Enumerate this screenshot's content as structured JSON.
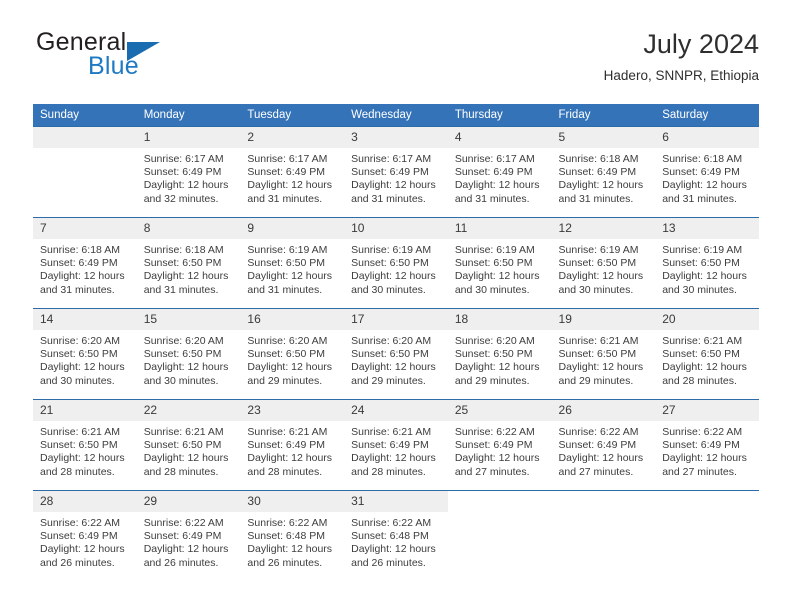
{
  "brand": {
    "line1": "General",
    "line2": "Blue",
    "triangle_color": "#1a6cb0",
    "blue_color": "#1f7ac4"
  },
  "header": {
    "month_title": "July 2024",
    "location": "Hadero, SNNPR, Ethiopia"
  },
  "theme": {
    "header_row_bg": "#3573b9",
    "daynum_bg": "#efefef",
    "row_divider": "#2d6ca8",
    "text": "#3d3d3d"
  },
  "weekdays": [
    "Sunday",
    "Monday",
    "Tuesday",
    "Wednesday",
    "Thursday",
    "Friday",
    "Saturday"
  ],
  "labels": {
    "sunrise_prefix": "Sunrise:",
    "sunset_prefix": "Sunset:",
    "daylight_prefix": "Daylight:"
  },
  "weeks": [
    [
      {
        "day": "",
        "sunrise": "",
        "sunset": "",
        "daylight": "",
        "empty": true
      },
      {
        "day": "1",
        "sunrise": "Sunrise: 6:17 AM",
        "sunset": "Sunset: 6:49 PM",
        "daylight": "Daylight: 12 hours and 32 minutes."
      },
      {
        "day": "2",
        "sunrise": "Sunrise: 6:17 AM",
        "sunset": "Sunset: 6:49 PM",
        "daylight": "Daylight: 12 hours and 31 minutes."
      },
      {
        "day": "3",
        "sunrise": "Sunrise: 6:17 AM",
        "sunset": "Sunset: 6:49 PM",
        "daylight": "Daylight: 12 hours and 31 minutes."
      },
      {
        "day": "4",
        "sunrise": "Sunrise: 6:17 AM",
        "sunset": "Sunset: 6:49 PM",
        "daylight": "Daylight: 12 hours and 31 minutes."
      },
      {
        "day": "5",
        "sunrise": "Sunrise: 6:18 AM",
        "sunset": "Sunset: 6:49 PM",
        "daylight": "Daylight: 12 hours and 31 minutes."
      },
      {
        "day": "6",
        "sunrise": "Sunrise: 6:18 AM",
        "sunset": "Sunset: 6:49 PM",
        "daylight": "Daylight: 12 hours and 31 minutes."
      }
    ],
    [
      {
        "day": "7",
        "sunrise": "Sunrise: 6:18 AM",
        "sunset": "Sunset: 6:49 PM",
        "daylight": "Daylight: 12 hours and 31 minutes."
      },
      {
        "day": "8",
        "sunrise": "Sunrise: 6:18 AM",
        "sunset": "Sunset: 6:50 PM",
        "daylight": "Daylight: 12 hours and 31 minutes."
      },
      {
        "day": "9",
        "sunrise": "Sunrise: 6:19 AM",
        "sunset": "Sunset: 6:50 PM",
        "daylight": "Daylight: 12 hours and 31 minutes."
      },
      {
        "day": "10",
        "sunrise": "Sunrise: 6:19 AM",
        "sunset": "Sunset: 6:50 PM",
        "daylight": "Daylight: 12 hours and 30 minutes."
      },
      {
        "day": "11",
        "sunrise": "Sunrise: 6:19 AM",
        "sunset": "Sunset: 6:50 PM",
        "daylight": "Daylight: 12 hours and 30 minutes."
      },
      {
        "day": "12",
        "sunrise": "Sunrise: 6:19 AM",
        "sunset": "Sunset: 6:50 PM",
        "daylight": "Daylight: 12 hours and 30 minutes."
      },
      {
        "day": "13",
        "sunrise": "Sunrise: 6:19 AM",
        "sunset": "Sunset: 6:50 PM",
        "daylight": "Daylight: 12 hours and 30 minutes."
      }
    ],
    [
      {
        "day": "14",
        "sunrise": "Sunrise: 6:20 AM",
        "sunset": "Sunset: 6:50 PM",
        "daylight": "Daylight: 12 hours and 30 minutes."
      },
      {
        "day": "15",
        "sunrise": "Sunrise: 6:20 AM",
        "sunset": "Sunset: 6:50 PM",
        "daylight": "Daylight: 12 hours and 30 minutes."
      },
      {
        "day": "16",
        "sunrise": "Sunrise: 6:20 AM",
        "sunset": "Sunset: 6:50 PM",
        "daylight": "Daylight: 12 hours and 29 minutes."
      },
      {
        "day": "17",
        "sunrise": "Sunrise: 6:20 AM",
        "sunset": "Sunset: 6:50 PM",
        "daylight": "Daylight: 12 hours and 29 minutes."
      },
      {
        "day": "18",
        "sunrise": "Sunrise: 6:20 AM",
        "sunset": "Sunset: 6:50 PM",
        "daylight": "Daylight: 12 hours and 29 minutes."
      },
      {
        "day": "19",
        "sunrise": "Sunrise: 6:21 AM",
        "sunset": "Sunset: 6:50 PM",
        "daylight": "Daylight: 12 hours and 29 minutes."
      },
      {
        "day": "20",
        "sunrise": "Sunrise: 6:21 AM",
        "sunset": "Sunset: 6:50 PM",
        "daylight": "Daylight: 12 hours and 28 minutes."
      }
    ],
    [
      {
        "day": "21",
        "sunrise": "Sunrise: 6:21 AM",
        "sunset": "Sunset: 6:50 PM",
        "daylight": "Daylight: 12 hours and 28 minutes."
      },
      {
        "day": "22",
        "sunrise": "Sunrise: 6:21 AM",
        "sunset": "Sunset: 6:50 PM",
        "daylight": "Daylight: 12 hours and 28 minutes."
      },
      {
        "day": "23",
        "sunrise": "Sunrise: 6:21 AM",
        "sunset": "Sunset: 6:49 PM",
        "daylight": "Daylight: 12 hours and 28 minutes."
      },
      {
        "day": "24",
        "sunrise": "Sunrise: 6:21 AM",
        "sunset": "Sunset: 6:49 PM",
        "daylight": "Daylight: 12 hours and 28 minutes."
      },
      {
        "day": "25",
        "sunrise": "Sunrise: 6:22 AM",
        "sunset": "Sunset: 6:49 PM",
        "daylight": "Daylight: 12 hours and 27 minutes."
      },
      {
        "day": "26",
        "sunrise": "Sunrise: 6:22 AM",
        "sunset": "Sunset: 6:49 PM",
        "daylight": "Daylight: 12 hours and 27 minutes."
      },
      {
        "day": "27",
        "sunrise": "Sunrise: 6:22 AM",
        "sunset": "Sunset: 6:49 PM",
        "daylight": "Daylight: 12 hours and 27 minutes."
      }
    ],
    [
      {
        "day": "28",
        "sunrise": "Sunrise: 6:22 AM",
        "sunset": "Sunset: 6:49 PM",
        "daylight": "Daylight: 12 hours and 26 minutes."
      },
      {
        "day": "29",
        "sunrise": "Sunrise: 6:22 AM",
        "sunset": "Sunset: 6:49 PM",
        "daylight": "Daylight: 12 hours and 26 minutes."
      },
      {
        "day": "30",
        "sunrise": "Sunrise: 6:22 AM",
        "sunset": "Sunset: 6:48 PM",
        "daylight": "Daylight: 12 hours and 26 minutes."
      },
      {
        "day": "31",
        "sunrise": "Sunrise: 6:22 AM",
        "sunset": "Sunset: 6:48 PM",
        "daylight": "Daylight: 12 hours and 26 minutes."
      },
      {
        "day": "",
        "sunrise": "",
        "sunset": "",
        "daylight": "",
        "empty": true,
        "blank": true
      },
      {
        "day": "",
        "sunrise": "",
        "sunset": "",
        "daylight": "",
        "empty": true,
        "blank": true
      },
      {
        "day": "",
        "sunrise": "",
        "sunset": "",
        "daylight": "",
        "empty": true,
        "blank": true
      }
    ]
  ]
}
